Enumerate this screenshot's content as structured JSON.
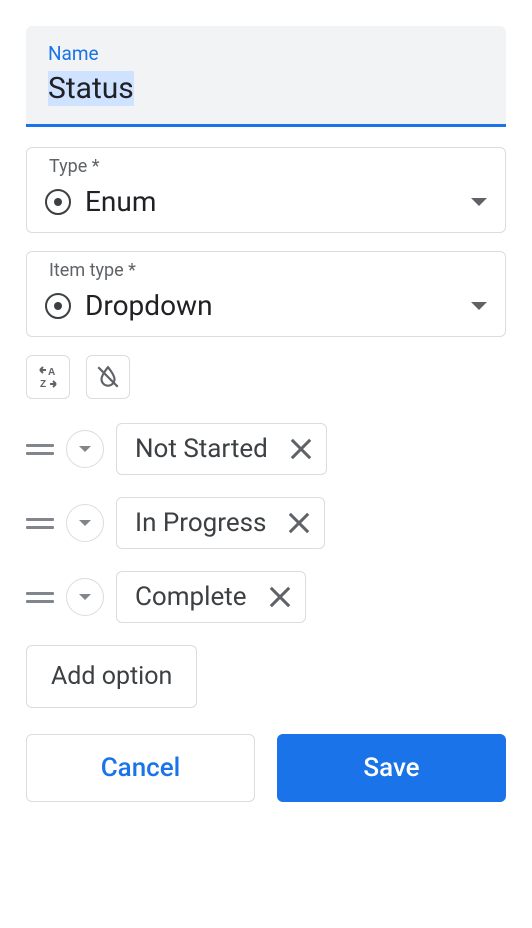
{
  "nameField": {
    "label": "Name",
    "value": "Status"
  },
  "typeField": {
    "label": "Type *",
    "value": "Enum"
  },
  "itemTypeField": {
    "label": "Item type *",
    "value": "Dropdown"
  },
  "options": [
    {
      "label": "Not Started"
    },
    {
      "label": "In Progress"
    },
    {
      "label": "Complete"
    }
  ],
  "addOptionLabel": "Add option",
  "buttons": {
    "cancel": "Cancel",
    "save": "Save"
  }
}
